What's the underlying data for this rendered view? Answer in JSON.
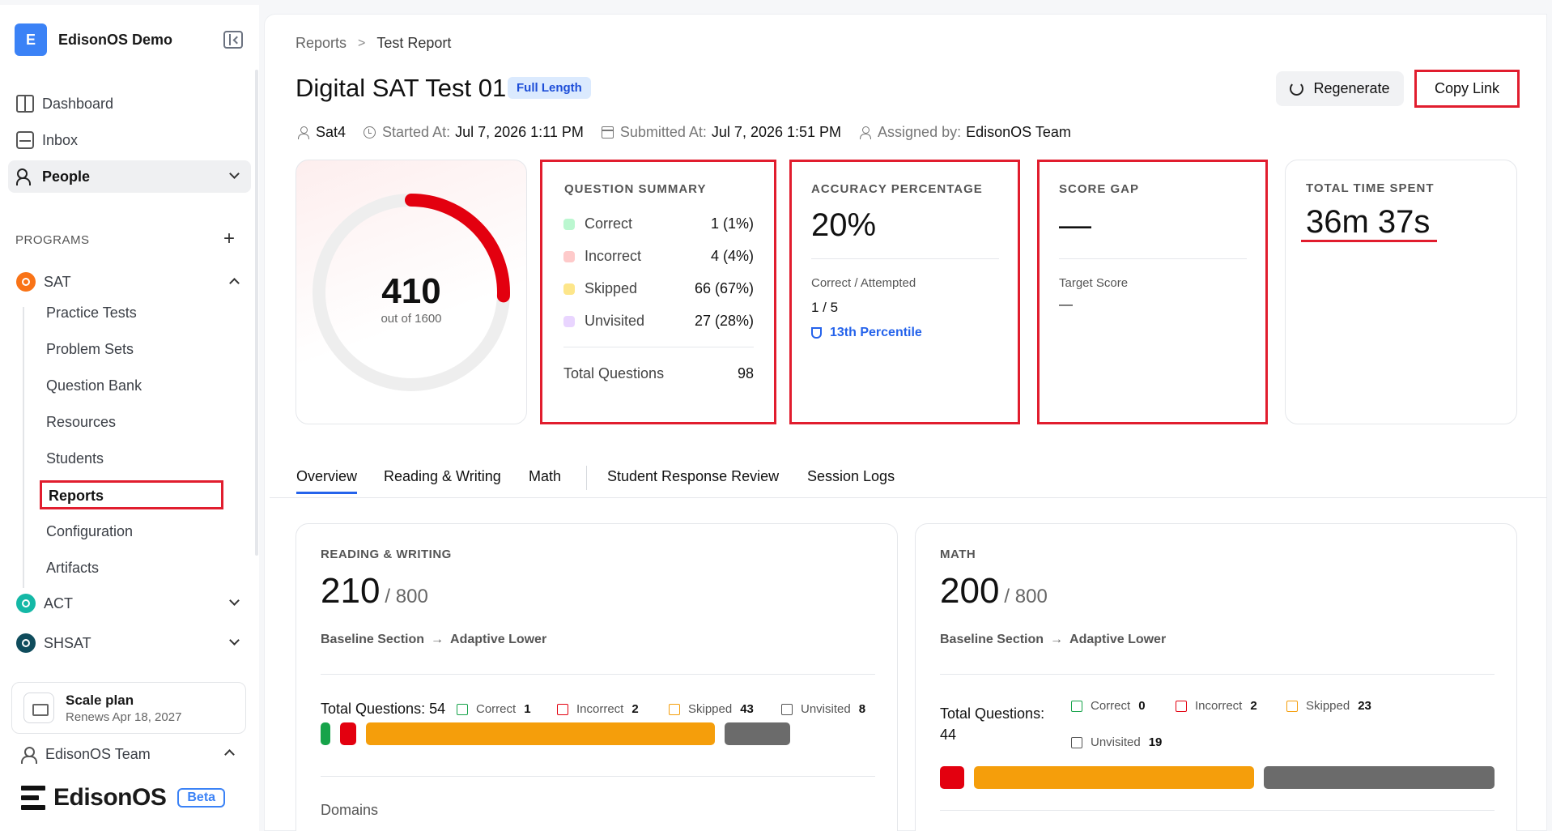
{
  "workspace": {
    "initial": "E",
    "name": "EdisonOS Demo"
  },
  "nav": [
    {
      "label": "Dashboard"
    },
    {
      "label": "Inbox"
    },
    {
      "label": "People"
    }
  ],
  "programs_label": "PROGRAMS",
  "programs": [
    {
      "label": "SAT"
    },
    {
      "label": "ACT"
    },
    {
      "label": "SHSAT"
    }
  ],
  "sat_sub": [
    "Practice Tests",
    "Problem Sets",
    "Question Bank",
    "Resources",
    "Students",
    "Reports",
    "Configuration",
    "Artifacts"
  ],
  "plan": {
    "name": "Scale plan",
    "renews": "Renews Apr 18, 2027"
  },
  "team": "EdisonOS Team",
  "brand": {
    "name": "EdisonOS",
    "badge": "Beta"
  },
  "breadcrumb": {
    "root": "Reports",
    "sep": ">",
    "current": "Test Report"
  },
  "report": {
    "title": "Digital SAT Test 01",
    "tag": "Full Length",
    "regenerate": "Regenerate",
    "copy_link": "Copy Link",
    "meta": {
      "student": "Sat4",
      "started_label": "Started At:",
      "started": "Jul 7, 2026 1:11 PM",
      "submitted_label": "Submitted At:",
      "submitted": "Jul 7, 2026 1:51 PM",
      "assigned_label": "Assigned by:",
      "assigned": "EdisonOS Team"
    }
  },
  "score": {
    "value": "410",
    "max_label": "out of 1600",
    "fraction": 0.256,
    "ring_color": "#e3000f"
  },
  "question_summary": {
    "title": "QUESTION SUMMARY",
    "rows": [
      {
        "label": "Correct",
        "value": "1 (1%)",
        "color": "#bbf7d0"
      },
      {
        "label": "Incorrect",
        "value": "4 (4%)",
        "color": "#fecaca"
      },
      {
        "label": "Skipped",
        "value": "66 (67%)",
        "color": "#fde68a"
      },
      {
        "label": "Unvisited",
        "value": "27 (28%)",
        "color": "#e9d5ff"
      }
    ],
    "total_label": "Total Questions",
    "total": "98"
  },
  "accuracy": {
    "title": "ACCURACY PERCENTAGE",
    "value": "20%",
    "sub_label": "Correct / Attempted",
    "sub_value": "1 / 5",
    "percentile": "13th Percentile"
  },
  "score_gap": {
    "title": "SCORE GAP",
    "value": "—",
    "sub_label": "Target Score",
    "sub_value": "—"
  },
  "time_spent": {
    "title": "TOTAL TIME SPENT",
    "value": "36m 37s"
  },
  "tabs": [
    "Overview",
    "Reading & Writing",
    "Math",
    "Student Response Review",
    "Session Logs"
  ],
  "sections": {
    "rw": {
      "title": "READING & WRITING",
      "score": "210",
      "max": "/ 800",
      "from": "Baseline Section",
      "arrow": "→",
      "to": "Adaptive Lower",
      "total_label": "Total Questions: 54",
      "legend": [
        {
          "label": "Correct",
          "n": "1"
        },
        {
          "label": "Incorrect",
          "n": "2"
        },
        {
          "label": "Skipped",
          "n": "43"
        },
        {
          "label": "Unvisited",
          "n": "8"
        }
      ],
      "domains": "Domains"
    },
    "math": {
      "title": "MATH",
      "score": "200",
      "max": "/ 800",
      "from": "Baseline Section",
      "arrow": "→",
      "to": "Adaptive Lower",
      "total_label": "Total Questions:",
      "total_n": "44",
      "legend": [
        {
          "label": "Correct",
          "n": "0"
        },
        {
          "label": "Incorrect",
          "n": "2"
        },
        {
          "label": "Skipped",
          "n": "23"
        },
        {
          "label": "Unvisited",
          "n": "19"
        }
      ]
    }
  },
  "colors": {
    "correct": "#16a34a",
    "incorrect": "#e3000f",
    "skipped": "#f59e0b",
    "unvisited": "#6b6b6b",
    "highlight": "#e11d2e"
  }
}
